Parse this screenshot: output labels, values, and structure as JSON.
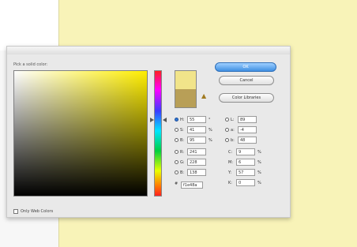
{
  "dialog": {
    "title": "",
    "section_label": "Pick a solid color:",
    "new_color": "#f1e48a",
    "current_color": "#b89f57",
    "only_web_colors_label": "Only Web Colors"
  },
  "buttons": {
    "ok": "OK",
    "cancel": "Cancel",
    "color_libraries": "Color Libraries"
  },
  "hsb_fields": [
    {
      "label": "H:",
      "value": "55",
      "unit": "°",
      "selected": true
    },
    {
      "label": "S:",
      "value": "41",
      "unit": "%",
      "selected": false
    },
    {
      "label": "B:",
      "value": "95",
      "unit": "%",
      "selected": false
    }
  ],
  "rgb_fields": [
    {
      "label": "R:",
      "value": "241",
      "selected": false
    },
    {
      "label": "G:",
      "value": "228",
      "selected": false
    },
    {
      "label": "B:",
      "value": "138",
      "selected": false
    }
  ],
  "lab_fields": [
    {
      "label": "L:",
      "value": "89",
      "selected": false
    },
    {
      "label": "a:",
      "value": "-4",
      "selected": false
    },
    {
      "label": "b:",
      "value": "48",
      "selected": false
    }
  ],
  "cmyk_fields": [
    {
      "label": "C:",
      "value": "9",
      "unit": "%"
    },
    {
      "label": "M:",
      "value": "6",
      "unit": "%"
    },
    {
      "label": "Y:",
      "value": "57",
      "unit": "%"
    },
    {
      "label": "K:",
      "value": "0",
      "unit": "%"
    }
  ],
  "hex": {
    "label": "#",
    "value": "f1e48a"
  }
}
